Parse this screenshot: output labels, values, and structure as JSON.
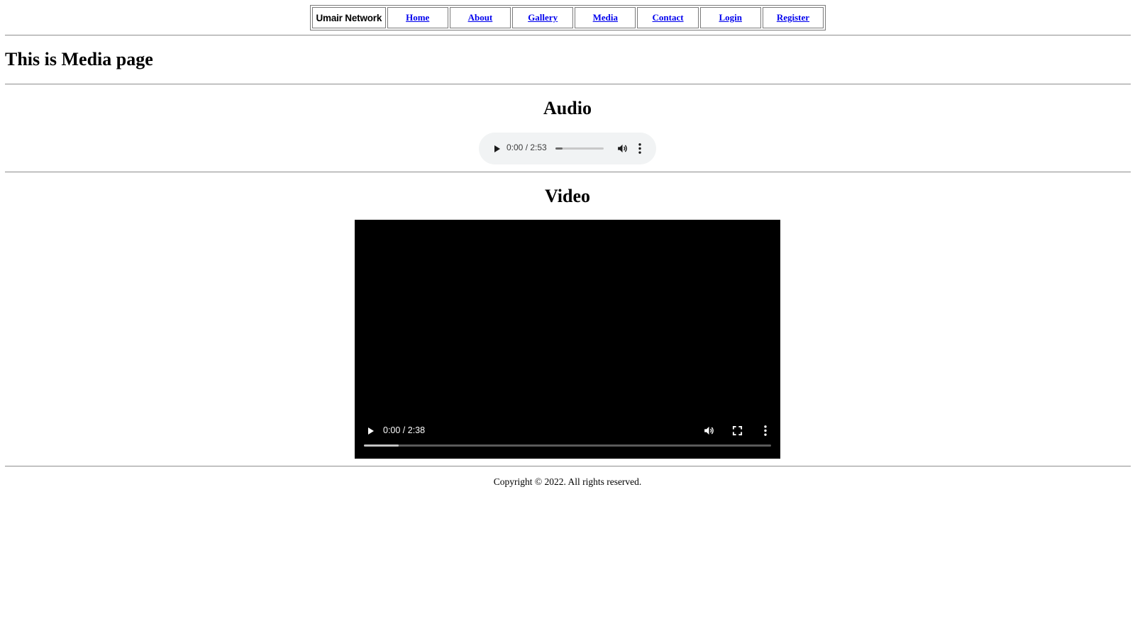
{
  "nav": {
    "brand": "Umair Network",
    "links": [
      {
        "label": "Home"
      },
      {
        "label": "About"
      },
      {
        "label": "Gallery"
      },
      {
        "label": "Media"
      },
      {
        "label": "Contact"
      },
      {
        "label": "Login"
      },
      {
        "label": "Register"
      }
    ],
    "link_color": "#0000ee"
  },
  "page": {
    "title": "This is Media page"
  },
  "audio": {
    "heading": "Audio",
    "time": "0:00 / 2:53",
    "progress_fraction": 0.15,
    "icons": {
      "play": "play-icon",
      "volume": "volume-icon",
      "more": "more-vertical-icon"
    },
    "background": "#f1f3f4"
  },
  "video": {
    "heading": "Video",
    "time": "0:00 / 2:38",
    "progress_fraction": 0.085,
    "icons": {
      "play": "play-icon",
      "volume": "volume-icon",
      "fullscreen": "fullscreen-icon",
      "more": "more-vertical-icon"
    },
    "background": "#000000"
  },
  "footer": {
    "copyright": "Copyright © 2022. All rights reserved."
  }
}
